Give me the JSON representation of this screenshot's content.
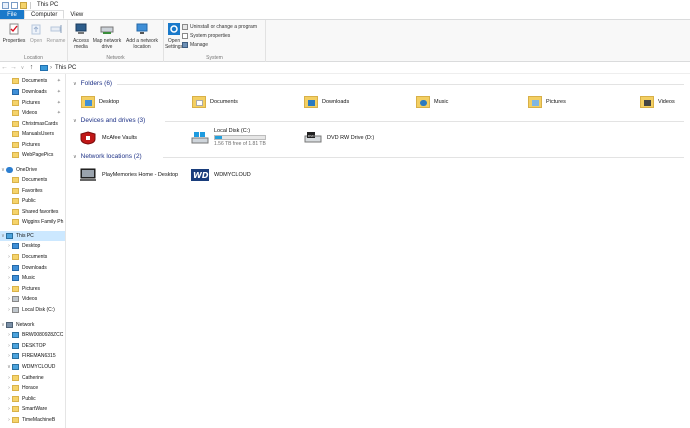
{
  "window": {
    "title": "This PC"
  },
  "tabs": [
    {
      "label": "File"
    },
    {
      "label": "Computer"
    },
    {
      "label": "View"
    }
  ],
  "ribbon": {
    "location": {
      "label": "Location",
      "properties": "Properties",
      "open": "Open",
      "rename": "Rename"
    },
    "network": {
      "label": "Network",
      "access_media": "Access\nmedia",
      "map_network_drive": "Map network\ndrive",
      "add_network_location": "Add a network\nlocation"
    },
    "system": {
      "label": "System",
      "open_settings": "Open\nSettings",
      "uninstall": "Uninstall or change a program",
      "system_properties": "System properties",
      "manage": "Manage"
    }
  },
  "address": {
    "path": "This PC"
  },
  "navpane": {
    "quick": [
      {
        "label": "Documents",
        "pinned": true
      },
      {
        "label": "Downloads",
        "pinned": true
      },
      {
        "label": "Pictures",
        "pinned": true
      },
      {
        "label": "Videos",
        "pinned": true
      },
      {
        "label": "ChristmasCards",
        "pinned": false
      },
      {
        "label": "ManualsUsers",
        "pinned": false
      },
      {
        "label": "Pictures",
        "pinned": false
      },
      {
        "label": "WebPagePics",
        "pinned": false
      }
    ],
    "onedrive": {
      "label": "OneDrive",
      "items": [
        "Documents",
        "Favorites",
        "Public",
        "Shared favorites",
        "Wiggins Family Ph"
      ]
    },
    "thispc": {
      "label": "This PC",
      "items": [
        "Desktop",
        "Documents",
        "Downloads",
        "Music",
        "Pictures",
        "Videos",
        "Local Disk (C:)"
      ]
    },
    "network": {
      "label": "Network",
      "items": [
        "BRW0080928ZCC",
        "DESKTOP",
        "FIREMAN6315",
        "WDMYCLOUD"
      ]
    },
    "wdmycloud_children": [
      "Catherine",
      "Horace",
      "Public",
      "SmartWare",
      "TimeMachineB"
    ]
  },
  "content": {
    "folders_header": "Folders (6)",
    "folders": [
      {
        "label": "Desktop",
        "icon": "desktop-folder-icon"
      },
      {
        "label": "Documents",
        "icon": "documents-folder-icon"
      },
      {
        "label": "Downloads",
        "icon": "downloads-folder-icon"
      },
      {
        "label": "Music",
        "icon": "music-folder-icon"
      },
      {
        "label": "Pictures",
        "icon": "pictures-folder-icon"
      },
      {
        "label": "Videos",
        "icon": "videos-folder-icon"
      }
    ],
    "devices_header": "Devices and drives (3)",
    "devices": {
      "mcafee": "McAfee Vaults",
      "localdisk": {
        "label": "Local Disk (C:)",
        "free": "1.56 TB free of 1.81 TB",
        "used_fraction": 0.14
      },
      "dvd": "DVD RW Drive (D:)"
    },
    "network_header": "Network locations (2)",
    "network": [
      {
        "label": "PlayMemories Home - Desktop"
      },
      {
        "label": "WDMYCLOUD"
      }
    ]
  },
  "colors": {
    "accent": "#1979ca",
    "section_header": "#1e3287",
    "selection": "#cce8ff",
    "drive_bar": "#26a0da"
  }
}
